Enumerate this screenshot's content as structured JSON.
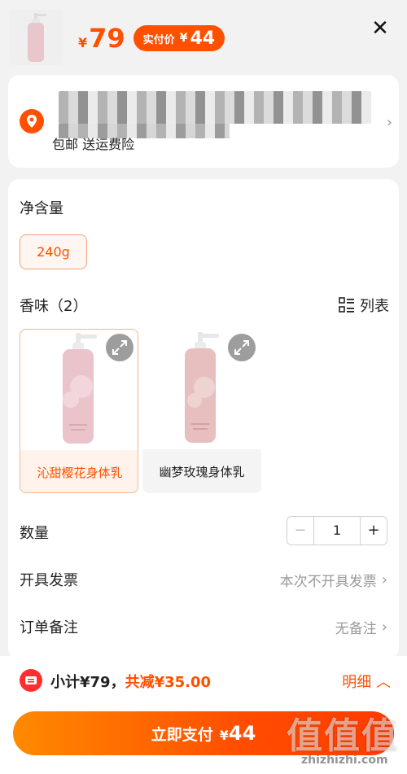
{
  "header": {
    "price_symbol": "¥",
    "price": "79",
    "real_price_label": "实付价",
    "real_price_symbol": "¥",
    "real_price": "44"
  },
  "address": {
    "tags": "包邮 送运费险"
  },
  "spec": {
    "net_content_title": "净含量",
    "net_content_option": "240g",
    "scent_title": "香味（2）",
    "list_toggle_label": "列表",
    "variants": [
      {
        "label": "沁甜樱花身体乳",
        "selected": true
      },
      {
        "label": "幽梦玫瑰身体乳",
        "selected": false
      }
    ],
    "quantity_title": "数量",
    "quantity_minus": "−",
    "quantity_value": "1",
    "quantity_plus": "+",
    "invoice_title": "开具发票",
    "invoice_value": "本次不开具发票",
    "remark_title": "订单备注",
    "remark_value": "无备注"
  },
  "footer": {
    "subtotal_label": "小计¥79，",
    "discount_label": "共减¥35.00",
    "detail_label": "明细",
    "pay_label": "立即支付",
    "pay_symbol": "¥",
    "pay_amount": "44"
  },
  "watermark": {
    "logo_text": "值值值",
    "site": "zhizhizhi.com"
  },
  "colors": {
    "accent": "#ff5000",
    "selected_bg": "#fff3ec",
    "product_pink": "#e9c5cc"
  },
  "icons": {
    "close": "close-icon",
    "location": "location-pin-icon",
    "list": "grid-list-icon",
    "expand": "expand-icon",
    "subtotal": "coupon-icon",
    "detail": "chevron-up-icon"
  }
}
